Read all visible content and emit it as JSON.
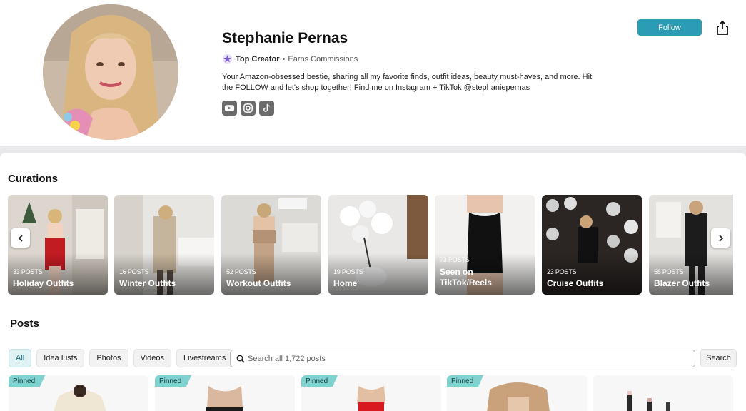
{
  "profile": {
    "name": "Stephanie Pernas",
    "badge": "Top Creator",
    "separator": "•",
    "commissions": "Earns Commissions",
    "bio": "Your Amazon-obsessed bestie, sharing all my favorite finds, outfit ideas, beauty must-haves, and more. Hit the FOLLOW and let's shop together! Find me on Instagram + TikTok @stephaniepernas",
    "socials": [
      "youtube-icon",
      "instagram-icon",
      "tiktok-icon"
    ],
    "follow_label": "Follow"
  },
  "curations": {
    "title": "Curations",
    "items": [
      {
        "count": "33 POSTS",
        "title": "Holiday Outfits"
      },
      {
        "count": "16 POSTS",
        "title": "Winter Outfits"
      },
      {
        "count": "52 POSTS",
        "title": "Workout Outfits"
      },
      {
        "count": "19 POSTS",
        "title": "Home"
      },
      {
        "count": "73 POSTS",
        "title": "Seen on TikTok/Reels"
      },
      {
        "count": "23 POSTS",
        "title": "Cruise Outfits"
      },
      {
        "count": "58 POSTS",
        "title": "Blazer Outfits"
      }
    ]
  },
  "posts": {
    "title": "Posts",
    "filters": [
      "All",
      "Idea Lists",
      "Photos",
      "Videos",
      "Livestreams"
    ],
    "active_filter": "All",
    "search_placeholder": "Search all 1,722 posts",
    "search_label": "Search",
    "items": [
      {
        "pinned": "Pinned"
      },
      {
        "pinned": "Pinned"
      },
      {
        "pinned": "Pinned"
      },
      {
        "pinned": "Pinned"
      },
      {
        "pinned": ""
      }
    ]
  },
  "colors": {
    "accent": "#2a9db4",
    "badge_star": "#7b5bd6",
    "pinned": "#7fd2cf"
  }
}
